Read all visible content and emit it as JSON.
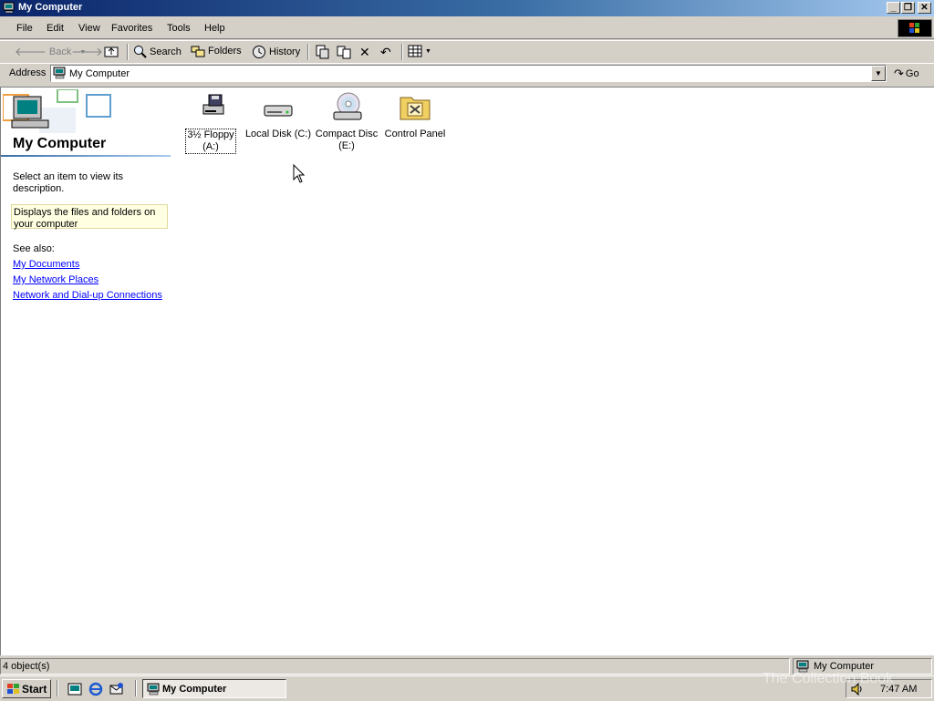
{
  "window": {
    "title": "My Computer"
  },
  "menu": [
    "File",
    "Edit",
    "View",
    "Favorites",
    "Tools",
    "Help"
  ],
  "toolbar": {
    "back": "Back",
    "search": "Search",
    "folders": "Folders",
    "history": "History"
  },
  "address": {
    "label": "Address",
    "value": "My Computer",
    "go": "Go"
  },
  "left_pane": {
    "title": "My Computer",
    "select_text": "Select an item to view its description.",
    "description": "Displays the files and folders on your computer",
    "see_also": "See also:",
    "links": [
      "My Documents",
      "My Network Places",
      "Network and Dial-up Connections"
    ]
  },
  "items": [
    {
      "line1": "3½ Floppy",
      "line2": "(A:)",
      "icon": "floppy-drive-icon"
    },
    {
      "line1": "Local Disk (C:)",
      "line2": "",
      "icon": "hard-disk-icon"
    },
    {
      "line1": "Compact Disc",
      "line2": "(E:)",
      "icon": "cd-drive-icon"
    },
    {
      "line1": "Control Panel",
      "line2": "",
      "icon": "control-panel-icon"
    }
  ],
  "status": {
    "left": "4 object(s)",
    "right": "My Computer"
  },
  "taskbar": {
    "start": "Start",
    "window": "My Computer",
    "clock": "7:47 AM"
  },
  "watermark": "The Collection Book",
  "colors": {
    "title_start": "#0a246a",
    "title_end": "#a6caf0",
    "link": "#0000ff",
    "face": "#d4d0c8"
  }
}
